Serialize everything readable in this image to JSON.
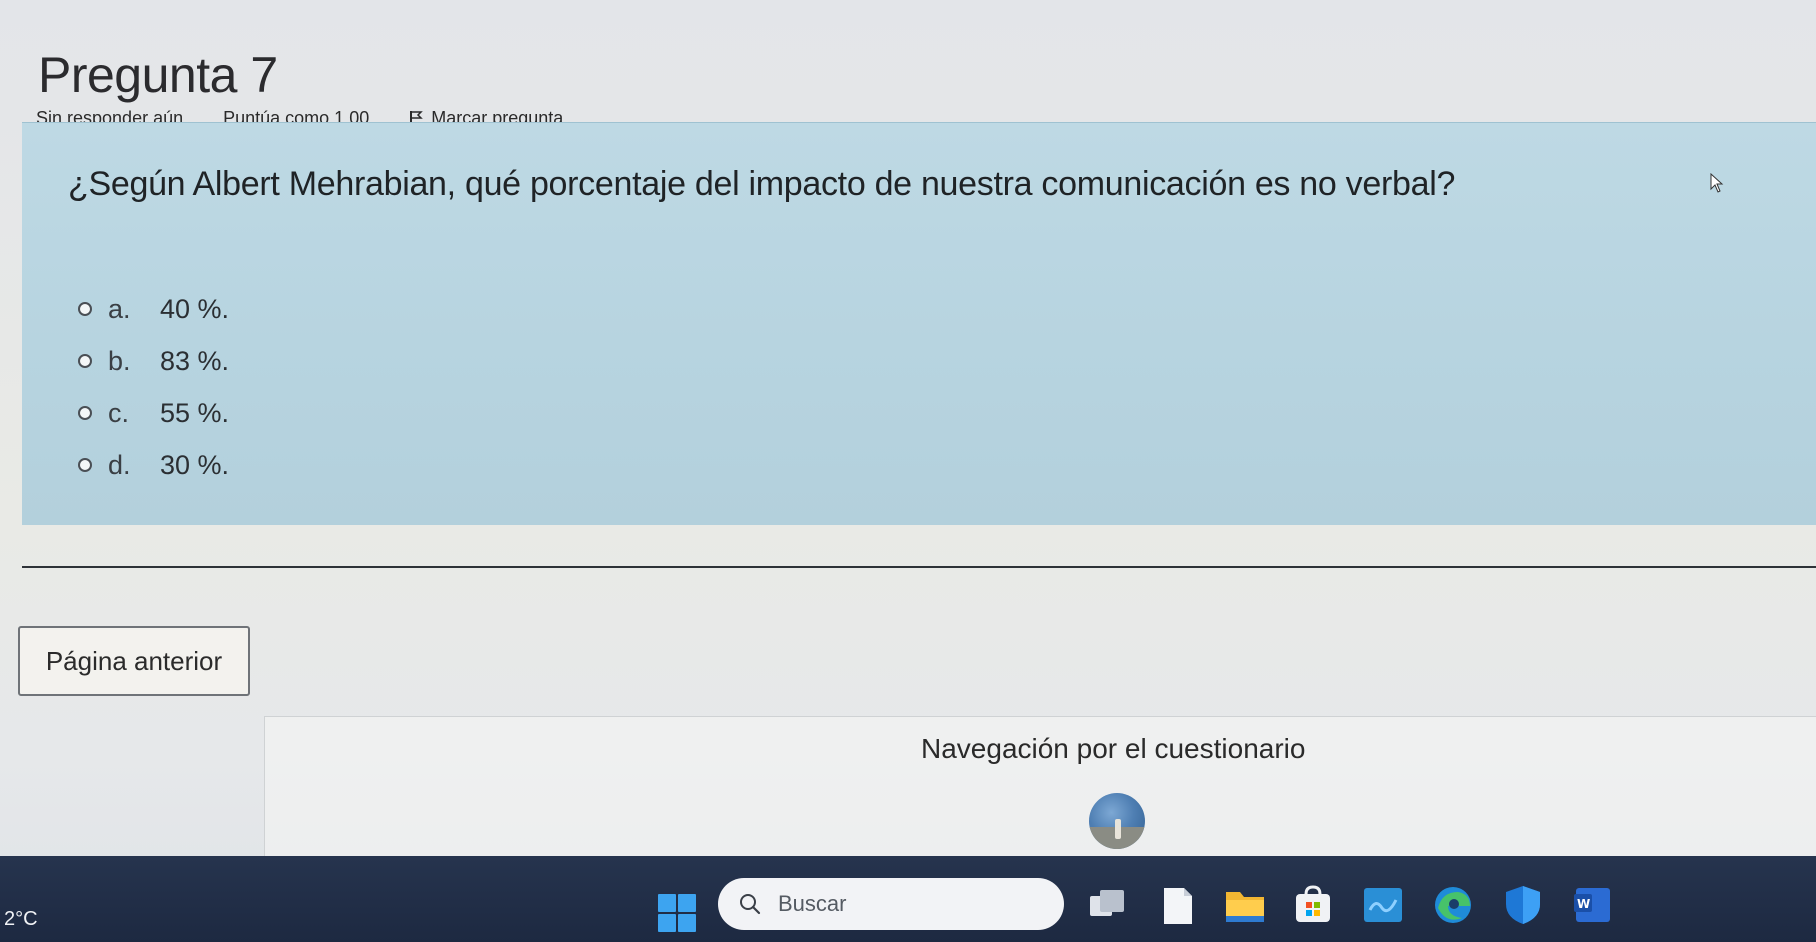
{
  "question": {
    "title": "Pregunta 7",
    "status": "Sin responder aún",
    "score": "Puntúa como 1,00",
    "flag_label": "Marcar pregunta",
    "text": "¿Según Albert Mehrabian, qué porcentaje del impacto de nuestra comunicación es no verbal?",
    "options": [
      {
        "letter": "a.",
        "text": "40 %."
      },
      {
        "letter": "b.",
        "text": "83 %."
      },
      {
        "letter": "c.",
        "text": "55 %."
      },
      {
        "letter": "d.",
        "text": "30 %."
      }
    ]
  },
  "buttons": {
    "previous_page": "Página anterior"
  },
  "navigation": {
    "title": "Navegación por el cuestionario"
  },
  "taskbar": {
    "weather": "2°C",
    "search_placeholder": "Buscar",
    "icons": [
      "start-icon",
      "task-view-icon",
      "notepad-icon",
      "file-explorer-icon",
      "store-icon",
      "teams-icon",
      "edge-icon",
      "defender-icon",
      "word-icon"
    ]
  },
  "colors": {
    "question_background": "#b9d5e1",
    "taskbar_background": "#22304a",
    "start_accent": "#3da4f0"
  }
}
